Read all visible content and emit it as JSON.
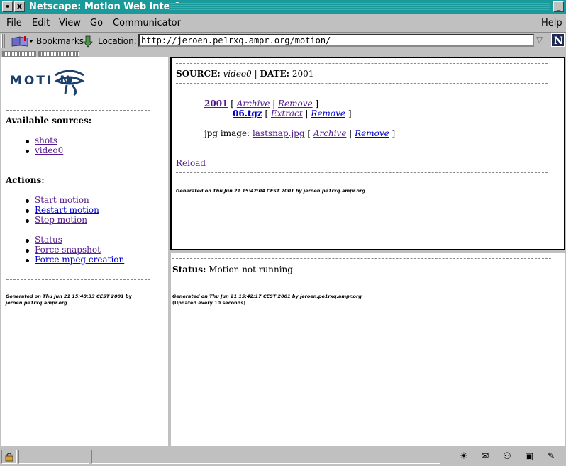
{
  "window": {
    "title": "Netscape: Motion Web interface"
  },
  "menubar": {
    "file": "File",
    "edit": "Edit",
    "view": "View",
    "go": "Go",
    "communicator": "Communicator",
    "help": "Help"
  },
  "toolbar": {
    "bookmarks": "Bookmarks",
    "location_label": "Location:",
    "url": "http://jeroen.pe1rxq.ampr.org/motion/"
  },
  "left": {
    "logo": "MOTI  N",
    "sources_heading": "Available sources:",
    "sources": [
      "shots",
      "video0"
    ],
    "actions_heading": "Actions:",
    "actions_group1": [
      "Start motion",
      "Restart motion",
      "Stop motion"
    ],
    "actions_group2": [
      "Status",
      "Force snapshot",
      "Force mpeg creation"
    ],
    "footer_line1": "Generated on Thu Jun 21 15:48:33 CEST 2001 by",
    "footer_line2": "jeroen.pe1rxq.ampr.org"
  },
  "top": {
    "source_label": "SOURCE:",
    "source_value": "video0",
    "sep": "|",
    "date_label": "DATE:",
    "date_value": "2001",
    "year_link": "2001",
    "archive": "Archive",
    "remove": "Remove",
    "file_link": "06.tgz",
    "extract": "Extract",
    "jpg_label": "jpg image:",
    "jpg_link": "lastsnap.jpg",
    "reload": "Reload",
    "footer": "Generated on Thu Jun 21 15:42:04 CEST 2001 by jeroen.pe1rxq.ampr.org"
  },
  "bottom": {
    "status_label": "Status:",
    "status_value": "Motion not running",
    "footer_line1": "Generated on Thu Jun 21 15:42:17 CEST 2001 by jeroen.pe1rxq.ampr.org",
    "footer_line2": "(Updated every 10 seconds)"
  }
}
